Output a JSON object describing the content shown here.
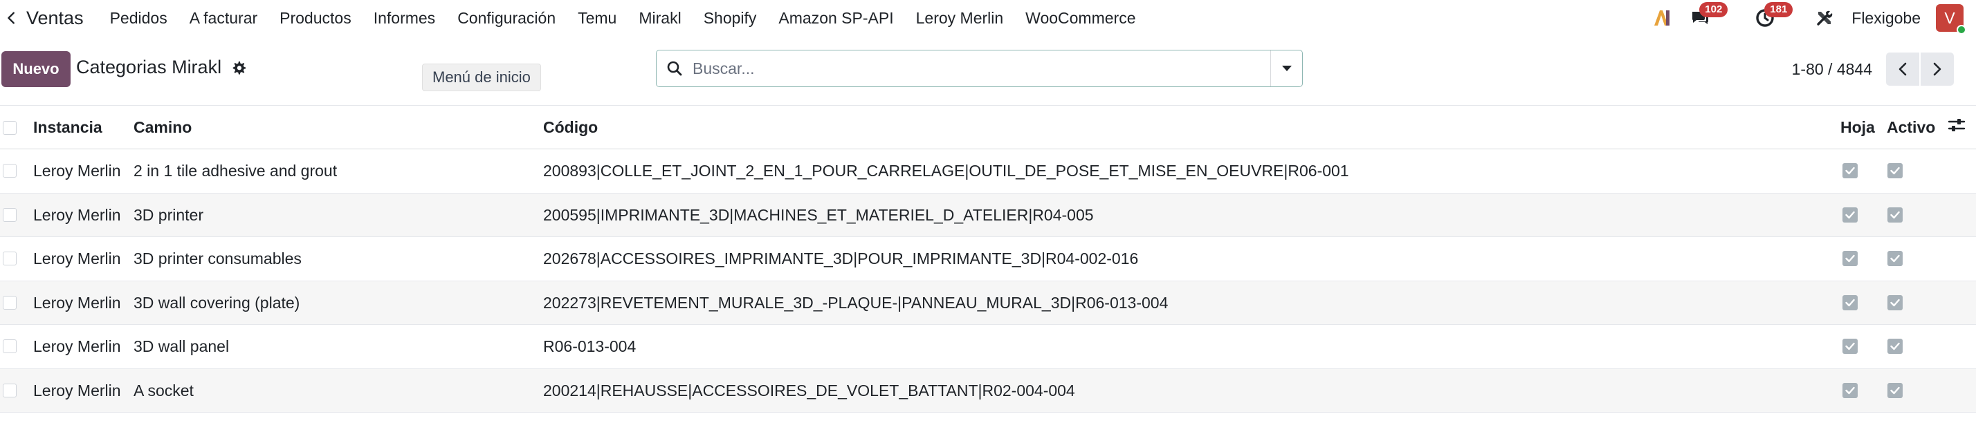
{
  "navbar": {
    "app_name": "Ventas",
    "menu": [
      "Pedidos",
      "A facturar",
      "Productos",
      "Informes",
      "Configuración",
      "Temu",
      "Mirakl",
      "Shopify",
      "Amazon SP-API",
      "Leroy Merlin",
      "WooCommerce"
    ],
    "messages_count": "102",
    "activities_count": "181",
    "company": "Flexigobe",
    "avatar_letter": "V"
  },
  "control": {
    "new_button": "Nuevo",
    "breadcrumb": "Categorias Mirakl",
    "tooltip": "Menú de inicio",
    "search_placeholder": "Buscar...",
    "pager": "1-80 / 4844"
  },
  "table": {
    "headers": {
      "instancia": "Instancia",
      "camino": "Camino",
      "codigo": "Código",
      "hoja": "Hoja",
      "activo": "Activo"
    },
    "rows": [
      {
        "instancia": "Leroy Merlin",
        "camino": "2 in 1 tile adhesive and grout",
        "codigo": "200893|COLLE_ET_JOINT_2_EN_1_POUR_CARRELAGE|OUTIL_DE_POSE_ET_MISE_EN_OEUVRE|R06-001",
        "hoja": true,
        "activo": true
      },
      {
        "instancia": "Leroy Merlin",
        "camino": "3D printer",
        "codigo": "200595|IMPRIMANTE_3D|MACHINES_ET_MATERIEL_D_ATELIER|R04-005",
        "hoja": true,
        "activo": true
      },
      {
        "instancia": "Leroy Merlin",
        "camino": "3D printer consumables",
        "codigo": "202678|ACCESSOIRES_IMPRIMANTE_3D|POUR_IMPRIMANTE_3D|R04-002-016",
        "hoja": true,
        "activo": true
      },
      {
        "instancia": "Leroy Merlin",
        "camino": "3D wall covering (plate)",
        "codigo": "202273|REVETEMENT_MURALE_3D_-PLAQUE-|PANNEAU_MURAL_3D|R06-013-004",
        "hoja": true,
        "activo": true
      },
      {
        "instancia": "Leroy Merlin",
        "camino": "3D wall panel",
        "codigo": "R06-013-004",
        "hoja": true,
        "activo": true
      },
      {
        "instancia": "Leroy Merlin",
        "camino": "A socket",
        "codigo": "200214|REHAUSSE|ACCESSOIRES_DE_VOLET_BATTANT|R02-004-004",
        "hoja": true,
        "activo": true
      }
    ]
  }
}
